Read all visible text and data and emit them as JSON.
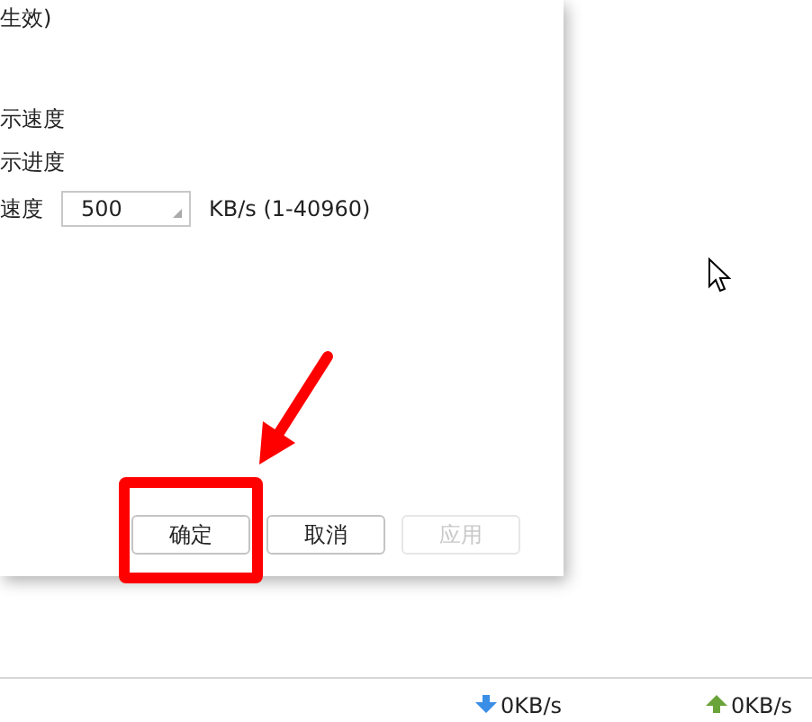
{
  "dialog": {
    "note": "生效)",
    "options": [
      {
        "label": "示速度"
      },
      {
        "label": "示进度"
      }
    ],
    "speed_limit": {
      "label": "速度",
      "value": "500",
      "unit": "KB/s (1-40960)"
    },
    "buttons": [
      {
        "label": "确定",
        "disabled": false
      },
      {
        "label": "取消",
        "disabled": false
      },
      {
        "label": "应用",
        "disabled": true
      }
    ]
  },
  "status_bar": [
    {
      "kind": "download",
      "text": "0KB/s"
    },
    {
      "kind": "upload",
      "text": "0KB/s"
    }
  ]
}
